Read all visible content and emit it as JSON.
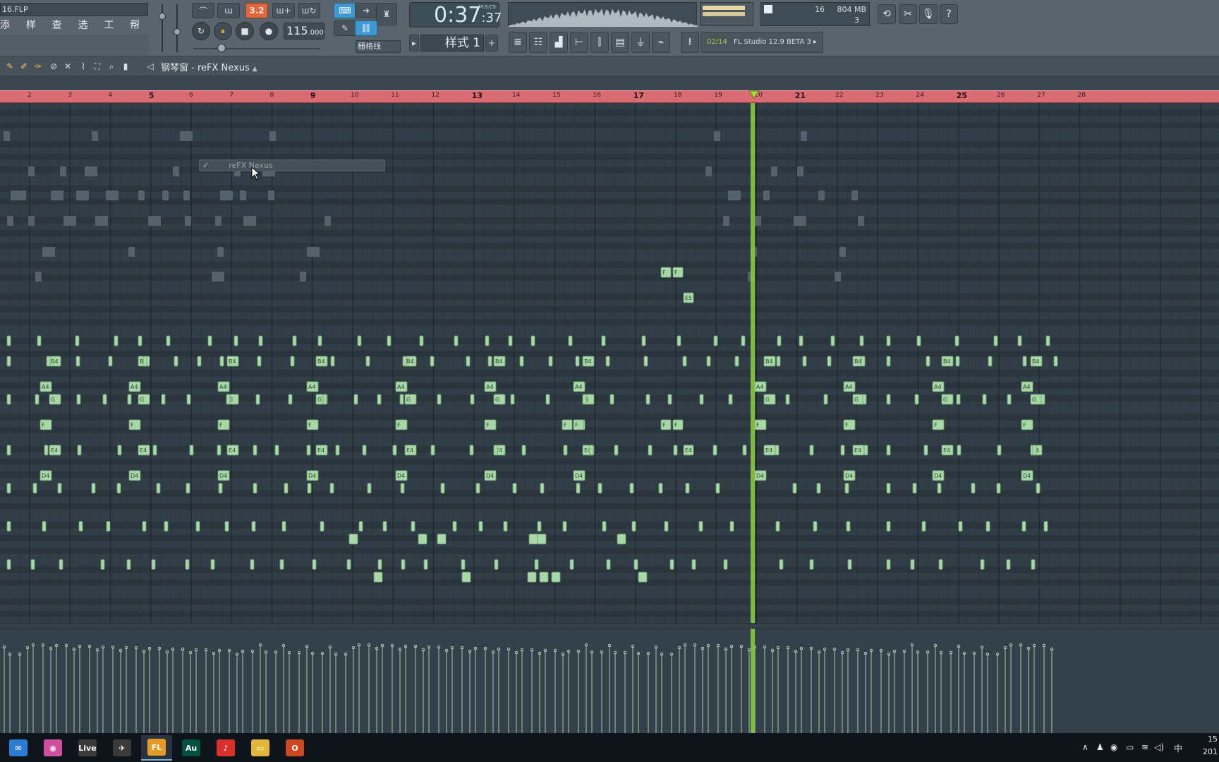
{
  "window": {
    "file_name": "16.FLP"
  },
  "menu": [
    "添加",
    "样式",
    "查看",
    "选项",
    "工具",
    "帮助"
  ],
  "transport": {
    "mode_label": "3.2",
    "tempo": "115",
    "tempo_fraction": ".000",
    "time": "0:37",
    "time_small": ":37",
    "time_format": "M:S:CS",
    "pattern_label": "样式 1",
    "snap_label": "栅格线",
    "play_symbol": "⏸",
    "stop_symbol": "■",
    "record_symbol": "●"
  },
  "monitor": {
    "voices": "16",
    "memory": "804 MB",
    "cpu": "3"
  },
  "news": {
    "counter": "02/14",
    "text": "FL Studio 12.9 BETA 3"
  },
  "piano_roll": {
    "title": "钢琴窗 - reFX Nexus",
    "channel_menu_item": "reFX Nexus",
    "bar_numbers": [
      "2",
      "3",
      "4",
      "5",
      "6",
      "7",
      "8",
      "9",
      "10",
      "11",
      "12",
      "13",
      "14",
      "15",
      "16",
      "17",
      "18",
      "19",
      "20",
      "21",
      "22",
      "23",
      "24",
      "25",
      "26",
      "27",
      "28"
    ]
  },
  "note_labels": [
    "B4",
    "A4",
    "G",
    "F",
    "E4",
    "D4",
    "E5",
    "F"
  ],
  "taskbar": {
    "apps": [
      {
        "name": "mail-app",
        "icon": "mail-icon",
        "color": "#2b7cd3",
        "label": "✉"
      },
      {
        "name": "color-app",
        "icon": "color-wheel-icon",
        "color": "#d24fa0",
        "label": "◉"
      },
      {
        "name": "live-app",
        "icon": "live-icon",
        "color": "#3a3a3a",
        "label": "Live"
      },
      {
        "name": "bird-app",
        "icon": "bird-icon",
        "color": "#3a3a3a",
        "label": "✈"
      },
      {
        "name": "flstudio-app",
        "icon": "fl-studio-icon",
        "color": "#e59a25",
        "label": "FL"
      },
      {
        "name": "audition-app",
        "icon": "audition-icon",
        "color": "#00513f",
        "label": "Au"
      },
      {
        "name": "music-app",
        "icon": "netease-music-icon",
        "color": "#d8302a",
        "label": "♪"
      },
      {
        "name": "files-app",
        "icon": "folder-icon",
        "color": "#e4b53b",
        "label": "▭"
      },
      {
        "name": "office-app",
        "icon": "office-icon",
        "color": "#d04723",
        "label": "O"
      }
    ],
    "ime": "中",
    "clock_time": "15",
    "clock_date": "201"
  },
  "colors": {
    "ruler": "#d96b72",
    "note": "#a8d8a8",
    "playhead": "#8fd13a",
    "grid_bg": "#2f3b45"
  }
}
